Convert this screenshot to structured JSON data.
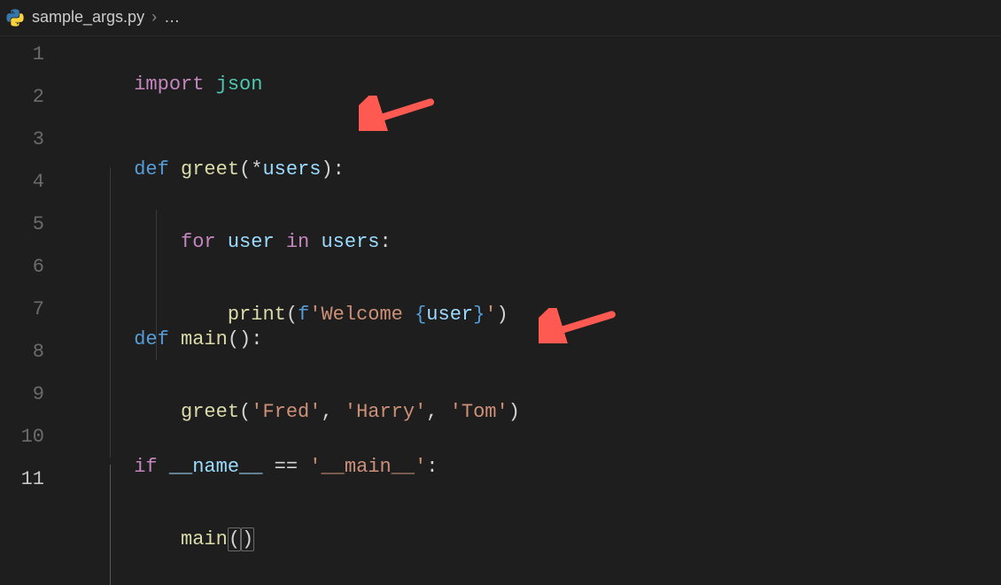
{
  "breadcrumb": {
    "filename": "sample_args.py",
    "separator": "›",
    "rest": "…"
  },
  "gutter": {
    "active_line": 11,
    "lines": [
      "1",
      "2",
      "3",
      "4",
      "5",
      "6",
      "7",
      "8",
      "9",
      "10",
      "11"
    ]
  },
  "code": {
    "l1": {
      "import": "import",
      "json": "json"
    },
    "l3": {
      "def": "def",
      "name": "greet",
      "lp": "(",
      "star": "*",
      "arg": "users",
      "rp": "):"
    },
    "l4": {
      "for": "for",
      "var": "user",
      "in": "in",
      "iter": "users",
      "colon": ":"
    },
    "l5": {
      "print": "print",
      "lp": "(",
      "f": "f",
      "s1": "'Welcome ",
      "lb": "{",
      "v": "user",
      "rb": "}",
      "s2": "'",
      "rp": ")"
    },
    "l7": {
      "def": "def",
      "name": "main",
      "lp": "(",
      "rp": "):"
    },
    "l8": {
      "call": "greet",
      "lp": "(",
      "a1": "'Fred'",
      "c1": ", ",
      "a2": "'Harry'",
      "c2": ", ",
      "a3": "'Tom'",
      "rp": ")"
    },
    "l10": {
      "if": "if",
      "name": "__name__",
      "eq": " == ",
      "main": "'__main__'",
      "colon": ":"
    },
    "l11": {
      "call": "main",
      "lp": "(",
      "rp": ")"
    }
  },
  "arrows": {
    "a1": {
      "target": "line-3"
    },
    "a2": {
      "target": "line-8"
    }
  }
}
